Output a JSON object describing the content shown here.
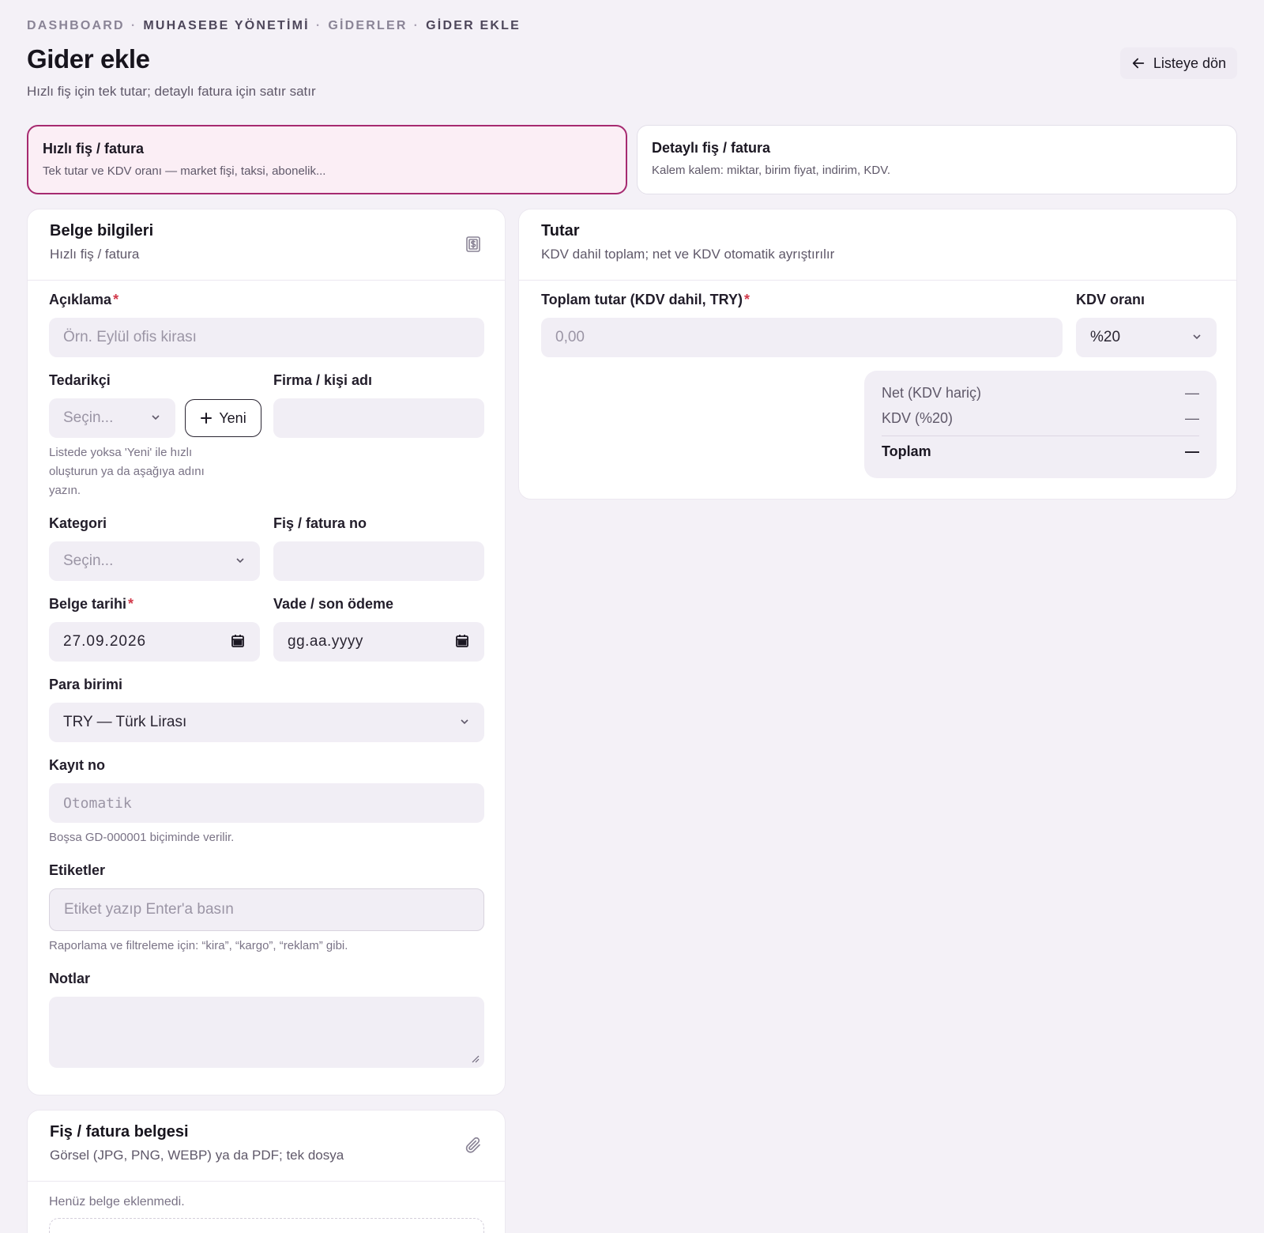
{
  "breadcrumb": {
    "items": [
      "DASHBOARD",
      "MUHASEBE YÖNETİMİ",
      "GİDERLER",
      "GİDER EKLE"
    ],
    "separator": "·"
  },
  "header": {
    "title": "Gider ekle",
    "subtitle": "Hızlı fiş için tek tutar; detaylı fatura için satır satır",
    "back_label": "Listeye dön"
  },
  "modes": [
    {
      "title": "Hızlı fiş / fatura",
      "desc": "Tek tutar ve KDV oranı — market fişi, taksi, abonelik...",
      "selected": true
    },
    {
      "title": "Detaylı fiş / fatura",
      "desc": "Kalem kalem: miktar, birim fiyat, indirim, KDV.",
      "selected": false
    }
  ],
  "document_card": {
    "title": "Belge bilgileri",
    "subtitle": "Hızlı fiş / fatura",
    "icon": "receipt-icon",
    "description": {
      "label": "Açıklama",
      "required": "*",
      "placeholder": "Örn. Eylül ofis kirası"
    },
    "supplier": {
      "label": "Tedarikçi",
      "placeholder": "Seçin...",
      "new_label": "Yeni",
      "hint": "Listede yoksa 'Yeni' ile hızlı oluşturun ya da aşağıya adını yazın."
    },
    "company": {
      "label": "Firma / kişi adı",
      "value": ""
    },
    "category": {
      "label": "Kategori",
      "placeholder": "Seçin..."
    },
    "receipt_no": {
      "label": "Fiş / fatura no",
      "value": ""
    },
    "doc_date": {
      "label": "Belge tarihi",
      "required": "*",
      "value": "27.09.2026"
    },
    "due_date": {
      "label": "Vade / son ödeme",
      "placeholder": "gg.aa.yyyy"
    },
    "currency": {
      "label": "Para birimi",
      "value": "TRY — Türk Lirası"
    },
    "record_no": {
      "label": "Kayıt no",
      "placeholder": "Otomatik",
      "hint": "Boşsa GD-000001 biçiminde verilir."
    },
    "tags": {
      "label": "Etiketler",
      "placeholder": "Etiket yazıp Enter'a basın",
      "hint": "Raporlama ve filtreleme için: “kira”, “kargo”, “reklam” gibi."
    },
    "notes": {
      "label": "Notlar",
      "value": ""
    }
  },
  "amount_card": {
    "title": "Tutar",
    "subtitle": "KDV dahil toplam; net ve KDV otomatik ayrıştırılır",
    "total": {
      "label": "Toplam tutar (KDV dahil, TRY)",
      "required": "*",
      "placeholder": "0,00"
    },
    "vat_rate": {
      "label": "KDV oranı",
      "value": "%20"
    },
    "summary": {
      "net_label": "Net (KDV hariç)",
      "net_value": "—",
      "vat_label": "KDV (%20)",
      "vat_value": "—",
      "total_label": "Toplam",
      "total_value": "—"
    }
  },
  "attachment_card": {
    "title": "Fiş / fatura belgesi",
    "subtitle": "Görsel (JPG, PNG, WEBP) ya da PDF; tek dosya",
    "icon": "paperclip-icon",
    "empty_text": "Henüz belge eklenmedi."
  },
  "colors": {
    "accent": "#a62a70",
    "accent_bg": "#fbeef5",
    "page_bg": "#f4f1f7",
    "field_bg": "#f1eef5",
    "required": "#d23a4b"
  }
}
